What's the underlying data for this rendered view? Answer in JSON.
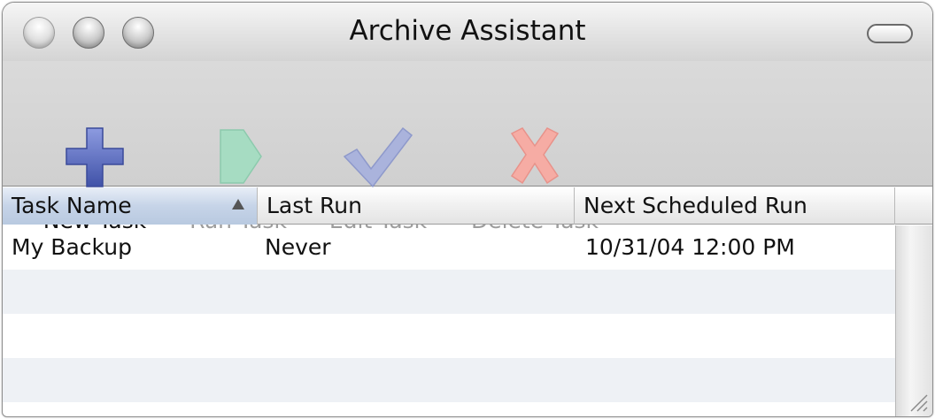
{
  "window": {
    "title": "Archive Assistant"
  },
  "toolbar": {
    "items": [
      {
        "label": "New Task",
        "enabled": true,
        "icon": "plus-icon",
        "color": "#5566b8"
      },
      {
        "label": "Run Task",
        "enabled": false,
        "icon": "play-icon",
        "color": "#a6dcc2"
      },
      {
        "label": "Edit Task",
        "enabled": false,
        "icon": "checkmark-icon",
        "color": "#9aa6d4"
      },
      {
        "label": "Delete Task",
        "enabled": false,
        "icon": "x-icon",
        "color": "#f4a19a"
      }
    ]
  },
  "table": {
    "columns": [
      {
        "label": "Task Name",
        "sorted": true,
        "sort_direction": "ascending"
      },
      {
        "label": "Last Run"
      },
      {
        "label": "Next Scheduled Run"
      }
    ],
    "rows": [
      {
        "task_name": "My Backup",
        "last_run": "Never",
        "next_scheduled_run": "10/31/04 12:00 PM"
      }
    ]
  },
  "colors": {
    "sorted_header": "#c6d4e8",
    "alt_row": "#eef1f5"
  }
}
